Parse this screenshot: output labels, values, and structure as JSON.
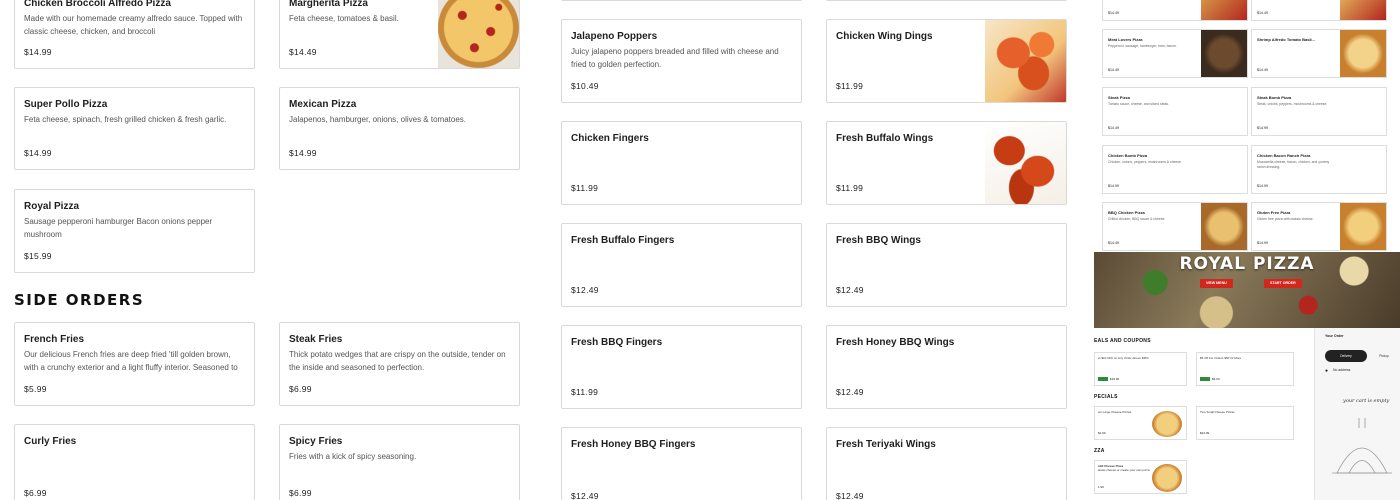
{
  "colors": {
    "accent_red": "#d2271d",
    "coupon_green": "#2e8b3e"
  },
  "pizzas": [
    {
      "name": "Chicken Broccoli Alfredo Pizza",
      "desc": "Made with our homemade creamy alfredo sauce. Topped with classic cheese, chicken, and broccoli",
      "price": "$14.99"
    },
    {
      "name": "Margherita Pizza",
      "desc": "Feta cheese, tomatoes & basil.",
      "price": "$14.49",
      "image": "margherita-pizza-photo"
    },
    {
      "name": "Super Pollo Pizza",
      "desc": "Feta cheese, spinach, fresh grilled chicken & fresh garlic.",
      "price": "$14.99"
    },
    {
      "name": "Mexican Pizza",
      "desc": "Jalapenos, hamburger, onions, olives & tomatoes.",
      "price": "$14.99"
    },
    {
      "name": "Royal Pizza",
      "desc": "Sausage pepperoni hamburger Bacon onions pepper mushroom",
      "price": "$15.99"
    }
  ],
  "side_orders_title": "SIDE ORDERS",
  "sides": [
    {
      "name": "French Fries",
      "desc": "Our delicious French fries are deep fried 'till golden brown, with a crunchy exterior and a light fluffy interior. Seasoned to",
      "price": "$5.99"
    },
    {
      "name": "Steak Fries",
      "desc": "Thick potato wedges that are crispy on the outside, tender on the inside and seasoned to perfection.",
      "price": "$6.99"
    },
    {
      "name": "Curly Fries",
      "desc": "",
      "price": "$6.99"
    },
    {
      "name": "Spicy Fries",
      "desc": "Fries with a kick of spicy seasoning.",
      "price": "$6.99"
    }
  ],
  "appetizers": [
    {
      "name": "Jalapeno Poppers",
      "desc": "Juicy jalapeno poppers breaded and filled with cheese and fried to golden perfection.",
      "price": "$10.49"
    },
    {
      "name": "Chicken Wing Dings",
      "desc": "",
      "price": "$11.99",
      "image": "wing-dings-photo"
    },
    {
      "name": "Chicken Fingers",
      "desc": "",
      "price": "$11.99"
    },
    {
      "name": "Fresh Buffalo Wings",
      "desc": "",
      "price": "$11.99",
      "image": "buffalo-wings-photo"
    },
    {
      "name": "Fresh Buffalo Fingers",
      "desc": "",
      "price": "$12.49"
    },
    {
      "name": "Fresh BBQ Wings",
      "desc": "",
      "price": "$12.49"
    },
    {
      "name": "Fresh BBQ Fingers",
      "desc": "",
      "price": "$11.99"
    },
    {
      "name": "Fresh Honey BBQ Wings",
      "desc": "",
      "price": "$12.49"
    },
    {
      "name": "Fresh Honey BBQ Fingers",
      "desc": "",
      "price": "$12.49"
    },
    {
      "name": "Fresh Teriyaki Wings",
      "desc": "",
      "price": "$12.49"
    }
  ],
  "preview": {
    "top_prices": [
      "$14.49",
      "$14.49"
    ],
    "items": [
      {
        "name": "Meat Lovers Pizza",
        "desc": "Pepperoni, sausage, hamburger, ham, bacon.",
        "price": "$14.49"
      },
      {
        "name": "Shrimp Alfredo Tomato Basil...",
        "desc": "",
        "price": "$14.49"
      },
      {
        "name": "Steak Pizza",
        "desc": "Tomato sauce, cheese, and sliced steak.",
        "price": "$14.49"
      },
      {
        "name": "Steak Bomb Pizza",
        "desc": "Steak, onions, peppers, mushrooms & cheese.",
        "price": "$14.99"
      },
      {
        "name": "Chicken Bomb Pizza",
        "desc": "Chicken, onions, peppers, mushrooms & cheese.",
        "price": "$14.99"
      },
      {
        "name": "Chicken Bacon Ranch Pizza",
        "desc": "Mozzarella cheese, bacon, chicken, and yummy ranch dressing.",
        "price": "$14.99"
      },
      {
        "name": "BBQ Chicken Pizza",
        "desc": "Grilled chicken, BBQ sauce & cheese.",
        "price": "$14.49"
      },
      {
        "name": "Gluten Free Pizza",
        "desc": "Gluten free pizza with classic cheese.",
        "price": "$14.99"
      }
    ],
    "hero_title": "ROYAL PIZZA",
    "view_menu": "VIEW MENU",
    "start_order": "START ORDER",
    "deals_heading": "EALS AND COUPONS",
    "coupons": [
      {
        "text": "et $10 OFF on Any Order Above $350",
        "tag": "",
        "price": "$15.00"
      },
      {
        "text": "$5 Off For Orders $50 Or More",
        "tag": "",
        "price": "$5.00"
      }
    ],
    "specials_heading": "PECIALS",
    "specials": [
      {
        "name": "wo Large Cheese Pizzas",
        "price": "$1.99"
      },
      {
        "name": "Two Small Cheese Pizzas",
        "price": "$24.99"
      }
    ],
    "pizza_heading": "ZZA",
    "pizza_item": {
      "name": "uild Cheese Pizza",
      "desc": "lassic cheese or create your own pizza.",
      "price": "1.99"
    },
    "your_order": "Your Order",
    "delivery": "Delivery",
    "pickup": "Pickup",
    "no_address": "No address",
    "empty_note": "your cart is empty"
  }
}
